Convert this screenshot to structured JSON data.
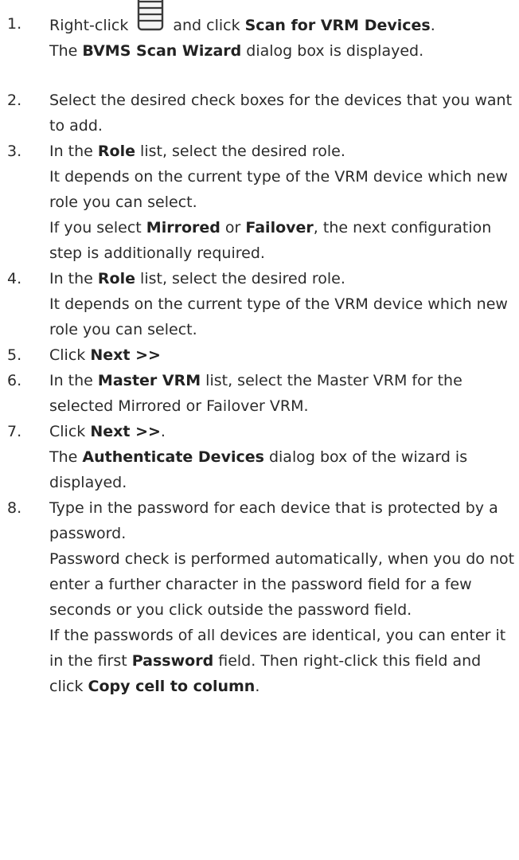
{
  "steps": [
    {
      "number": "1.",
      "lines": [
        {
          "parts": [
            {
              "t": "Right-click"
            },
            {
              "icon": "vrm-server-icon"
            },
            {
              "t": "and click "
            },
            {
              "t": "Scan for VRM Devices",
              "b": true
            },
            {
              "t": "."
            }
          ]
        },
        {
          "parts": [
            {
              "t": "The "
            },
            {
              "t": "BVMS Scan Wizard",
              "b": true
            },
            {
              "t": " dialog box is displayed."
            }
          ]
        }
      ]
    },
    {
      "number": "2.",
      "lines": [
        {
          "parts": [
            {
              "t": "Select the desired check boxes for the devices that you want to add."
            }
          ]
        }
      ]
    },
    {
      "number": "3.",
      "lines": [
        {
          "parts": [
            {
              "t": "In the "
            },
            {
              "t": "Role",
              "b": true
            },
            {
              "t": " list, select the desired role."
            }
          ]
        },
        {
          "parts": [
            {
              "t": "It depends on the current type of the VRM device which new role you can select."
            }
          ]
        },
        {
          "parts": [
            {
              "t": "If you select "
            },
            {
              "t": "Mirrored",
              "b": true
            },
            {
              "t": " or "
            },
            {
              "t": "Failover",
              "b": true
            },
            {
              "t": ", the next configuration step is additionally required."
            }
          ]
        }
      ]
    },
    {
      "number": "4.",
      "lines": [
        {
          "parts": [
            {
              "t": "In the "
            },
            {
              "t": "Role",
              "b": true
            },
            {
              "t": " list, select the desired role."
            }
          ]
        },
        {
          "parts": [
            {
              "t": "It depends on the current type of the VRM device which new role you can select."
            }
          ]
        }
      ]
    },
    {
      "number": "5.",
      "lines": [
        {
          "parts": [
            {
              "t": "Click "
            },
            {
              "t": "Next >>",
              "b": true
            }
          ]
        }
      ]
    },
    {
      "number": "6.",
      "lines": [
        {
          "parts": [
            {
              "t": "In the "
            },
            {
              "t": "Master VRM",
              "b": true
            },
            {
              "t": " list, select the Master VRM for the selected Mirrored or Failover VRM."
            }
          ]
        }
      ]
    },
    {
      "number": "7.",
      "lines": [
        {
          "parts": [
            {
              "t": "Click "
            },
            {
              "t": "Next >>",
              "b": true
            },
            {
              "t": "."
            }
          ]
        },
        {
          "parts": [
            {
              "t": "The "
            },
            {
              "t": "Authenticate Devices",
              "b": true
            },
            {
              "t": " dialog box of the wizard is displayed."
            }
          ]
        }
      ]
    },
    {
      "number": "8.",
      "lines": [
        {
          "parts": [
            {
              "t": "Type in the password for each device that is protected by a password."
            }
          ]
        },
        {
          "parts": [
            {
              "t": "Password check is performed automatically, when you do not enter a further character in the password field for a few seconds or you click outside the password field."
            }
          ]
        },
        {
          "parts": [
            {
              "t": "If the passwords of all devices are identical, you can enter it in the first "
            },
            {
              "t": "Password",
              "b": true
            },
            {
              "t": " field. Then right-click this field and click "
            },
            {
              "t": "Copy cell to column",
              "b": true
            },
            {
              "t": "."
            }
          ]
        }
      ]
    }
  ]
}
